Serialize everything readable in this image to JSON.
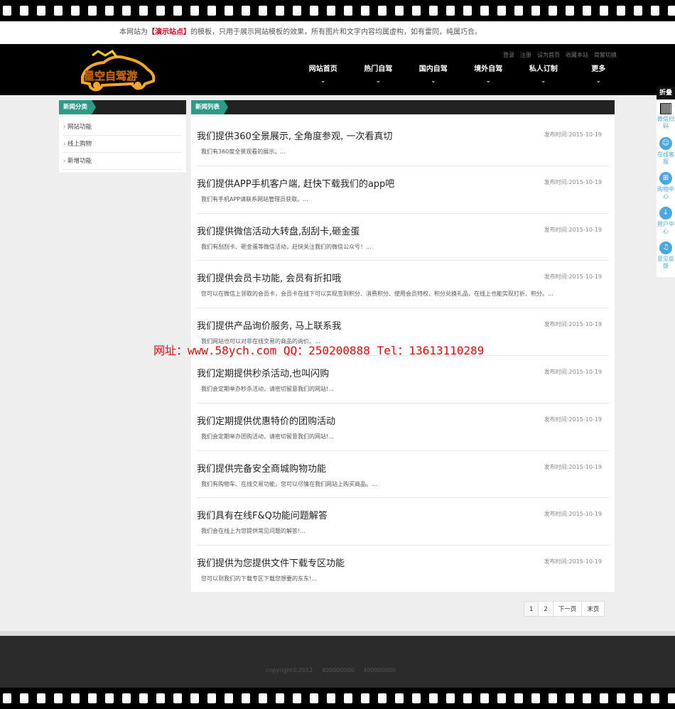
{
  "notice": {
    "prefix": "本网站为",
    "highlight": "【演示站点】",
    "suffix": "的模板，只用于展示网站模板的效果，所有图片和文字内容均属虚构，如有雷同，纯属巧合。"
  },
  "header": {
    "logo_text": "星空自驾游",
    "toplinks": [
      "登录",
      "注册",
      "设为首页",
      "收藏本站",
      "简繁切换"
    ],
    "nav": [
      {
        "label": "网站首页"
      },
      {
        "label": "热门自驾"
      },
      {
        "label": "国内自驾"
      },
      {
        "label": "境外自驾"
      },
      {
        "label": "私人订制"
      },
      {
        "label": "更多"
      }
    ]
  },
  "sidebar": {
    "title": "新闻分类",
    "items": [
      "网站功能",
      "线上购物",
      "新增功能"
    ]
  },
  "main": {
    "title": "新闻列表",
    "date_prefix": "发布时间:",
    "news": [
      {
        "title": "我们提供360全景展示, 全角度参观, 一次看真切",
        "date": "2015-10-19",
        "desc": "我们有360度全景观看的展示。..."
      },
      {
        "title": "我们提供APP手机客户端, 赶快下载我们的app吧",
        "date": "2015-10-19",
        "desc": "我们有手机APP请联系网站管理员获取。..."
      },
      {
        "title": "我们提供微信活动大转盘,刮刮卡,砸金蛋",
        "date": "2015-10-19",
        "desc": "我们有刮刮卡、砸金蛋等微信活动，赶快关注我们的微信公众号！..."
      },
      {
        "title": "我们提供会员卡功能, 会员有折扣哦",
        "date": "2015-10-19",
        "desc": "您可以在微信上领取的会员卡，会员卡在线下可以实现签到积分、消费积分、使用会员特权、积分兑换礼品，在线上也能实现打折、积分。..."
      },
      {
        "title": "我们提供产品询价服务, 马上联系我",
        "date": "2015-10-19",
        "desc": "我们网站也可以对非在线交易的商品的询价。..."
      },
      {
        "title": "我们定期提供秒杀活动,也叫闪购",
        "date": "2015-10-19",
        "desc": "我们会定期举办秒杀活动，请密切留意我们的网站!..."
      },
      {
        "title": "我们定期提供优惠特价的团购活动",
        "date": "2015-10-19",
        "desc": "我们会定期举办团购活动，请密切留意我们的网站!..."
      },
      {
        "title": "我们提供完备安全商城购物功能",
        "date": "2015-10-19",
        "desc": "我们有购物车、在线交易功能，您可以尽情在我们网站上购买商品。..."
      },
      {
        "title": "我们具有在线F&Q功能问题解答",
        "date": "2015-10-19",
        "desc": "我们会在线上为您提供常见问题的解答!..."
      },
      {
        "title": "我们提供为您提供文件下载专区功能",
        "date": "2015-10-19",
        "desc": "您可以到我们的下载专区下载您想要的东东!..."
      }
    ]
  },
  "watermark": "网址：www.58ych.com QQ：250200888 Tel：13613110289",
  "pager": [
    "1",
    "2",
    "下一页",
    "末页"
  ],
  "footer": {
    "copyright": "copyright©2012",
    "phone1": "400000000",
    "phone2": "400000000"
  },
  "float": {
    "fold": "折叠",
    "items": [
      {
        "label": "微信扫码",
        "icon": "qr-icon"
      },
      {
        "label": "在线客服",
        "icon": "service-icon"
      },
      {
        "label": "购物中心",
        "icon": "cart-icon"
      },
      {
        "label": "用户中心",
        "icon": "user-icon"
      },
      {
        "label": "意见反馈",
        "icon": "headset-icon"
      }
    ]
  }
}
